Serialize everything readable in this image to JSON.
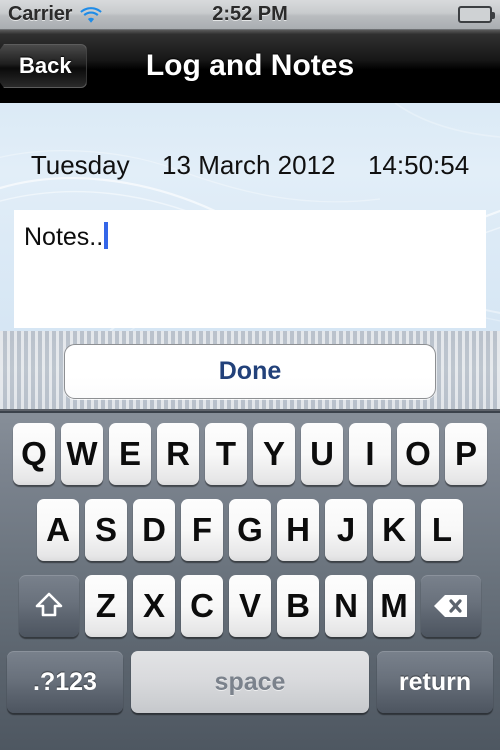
{
  "status_bar": {
    "carrier": "Carrier",
    "wifi_icon": "wifi-icon",
    "time": "2:52 PM",
    "battery_icon": "battery-full-icon"
  },
  "nav_bar": {
    "back_label": "Back",
    "title": "Log and Notes"
  },
  "content": {
    "weekday": "Tuesday",
    "date": "13 March 2012",
    "time": "14:50:54",
    "notes_value": "Notes..",
    "notes_caret_color": "#3466e8"
  },
  "accessory_bar": {
    "done_label": "Done",
    "done_text_color": "#22417a"
  },
  "keyboard": {
    "row1": [
      "Q",
      "W",
      "E",
      "R",
      "T",
      "Y",
      "U",
      "I",
      "O",
      "P"
    ],
    "row2": [
      "A",
      "S",
      "D",
      "F",
      "G",
      "H",
      "J",
      "K",
      "L"
    ],
    "row3": [
      "Z",
      "X",
      "C",
      "V",
      "B",
      "N",
      "M"
    ],
    "shift_icon": "shift-arrow-icon",
    "backspace_icon": "backspace-delete-icon",
    "numbers_label": ".?123",
    "space_label": "space",
    "return_label": "return"
  }
}
